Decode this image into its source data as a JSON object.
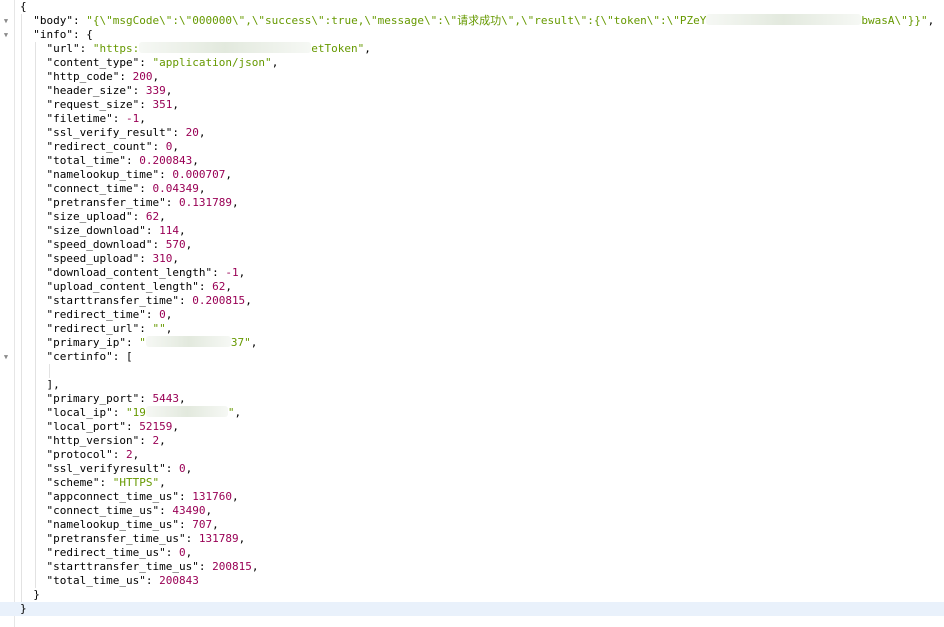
{
  "symbols": {
    "open_brace": "{",
    "close_brace": "}",
    "close_brace_comma": "},",
    "open_bracket": "[",
    "close_bracket_comma": "],",
    "colon": ": ",
    "comma": ","
  },
  "json_root": {
    "body_key": "\"body\"",
    "body_value_part1": "\"{\\\"msgCode\\\":\\\"000000\\\",\\\"success\\\":true,\\\"message\\\":\\\"请求成功\\\",\\\"result\\\":{\\\"token\\\":\\\"PZeY",
    "body_value_part2": "\\\"}}\"",
    "body_value_part2b": "bwasA",
    "info_key": "\"info\""
  },
  "info_fields": [
    {
      "key": "\"url\"",
      "value_part1": "\"https:",
      "value_part2": "etToken\"",
      "type": "string"
    },
    {
      "key": "\"content_type\"",
      "value": "\"application/json\"",
      "type": "string"
    },
    {
      "key": "\"http_code\"",
      "value": "200",
      "type": "number"
    },
    {
      "key": "\"header_size\"",
      "value": "339",
      "type": "number"
    },
    {
      "key": "\"request_size\"",
      "value": "351",
      "type": "number"
    },
    {
      "key": "\"filetime\"",
      "value": "-1",
      "type": "number"
    },
    {
      "key": "\"ssl_verify_result\"",
      "value": "20",
      "type": "number"
    },
    {
      "key": "\"redirect_count\"",
      "value": "0",
      "type": "number"
    },
    {
      "key": "\"total_time\"",
      "value": "0.200843",
      "type": "number"
    },
    {
      "key": "\"namelookup_time\"",
      "value": "0.000707",
      "type": "number"
    },
    {
      "key": "\"connect_time\"",
      "value": "0.04349",
      "type": "number"
    },
    {
      "key": "\"pretransfer_time\"",
      "value": "0.131789",
      "type": "number"
    },
    {
      "key": "\"size_upload\"",
      "value": "62",
      "type": "number"
    },
    {
      "key": "\"size_download\"",
      "value": "114",
      "type": "number"
    },
    {
      "key": "\"speed_download\"",
      "value": "570",
      "type": "number"
    },
    {
      "key": "\"speed_upload\"",
      "value": "310",
      "type": "number"
    },
    {
      "key": "\"download_content_length\"",
      "value": "-1",
      "type": "number"
    },
    {
      "key": "\"upload_content_length\"",
      "value": "62",
      "type": "number"
    },
    {
      "key": "\"starttransfer_time\"",
      "value": "0.200815",
      "type": "number"
    },
    {
      "key": "\"redirect_time\"",
      "value": "0",
      "type": "number"
    },
    {
      "key": "\"redirect_url\"",
      "value": "\"\"",
      "type": "string"
    },
    {
      "key": "\"primary_ip\"",
      "value_part1": "\"",
      "value_part2": "37\"",
      "type": "string"
    },
    {
      "key": "\"certinfo\"",
      "type": "array"
    },
    {
      "key": "\"primary_port\"",
      "value": "5443",
      "type": "number"
    },
    {
      "key": "\"local_ip\"",
      "value_part1": "\"19",
      "value_part2": "\"",
      "type": "string"
    },
    {
      "key": "\"local_port\"",
      "value": "52159",
      "type": "number"
    },
    {
      "key": "\"http_version\"",
      "value": "2",
      "type": "number"
    },
    {
      "key": "\"protocol\"",
      "value": "2",
      "type": "number"
    },
    {
      "key": "\"ssl_verifyresult\"",
      "value": "0",
      "type": "number"
    },
    {
      "key": "\"scheme\"",
      "value": "\"HTTPS\"",
      "type": "string"
    },
    {
      "key": "\"appconnect_time_us\"",
      "value": "131760",
      "type": "number"
    },
    {
      "key": "\"connect_time_us\"",
      "value": "43490",
      "type": "number"
    },
    {
      "key": "\"namelookup_time_us\"",
      "value": "707",
      "type": "number"
    },
    {
      "key": "\"pretransfer_time_us\"",
      "value": "131789",
      "type": "number"
    },
    {
      "key": "\"redirect_time_us\"",
      "value": "0",
      "type": "number"
    },
    {
      "key": "\"starttransfer_time_us\"",
      "value": "200815",
      "type": "number"
    },
    {
      "key": "\"total_time_us\"",
      "value": "200843",
      "type": "number"
    }
  ],
  "colors": {
    "key": "#000000",
    "string": "#669900",
    "number": "#990055",
    "highlight_line": "#e9f1fb"
  },
  "icons": {
    "fold_open": "caret-down-icon"
  }
}
